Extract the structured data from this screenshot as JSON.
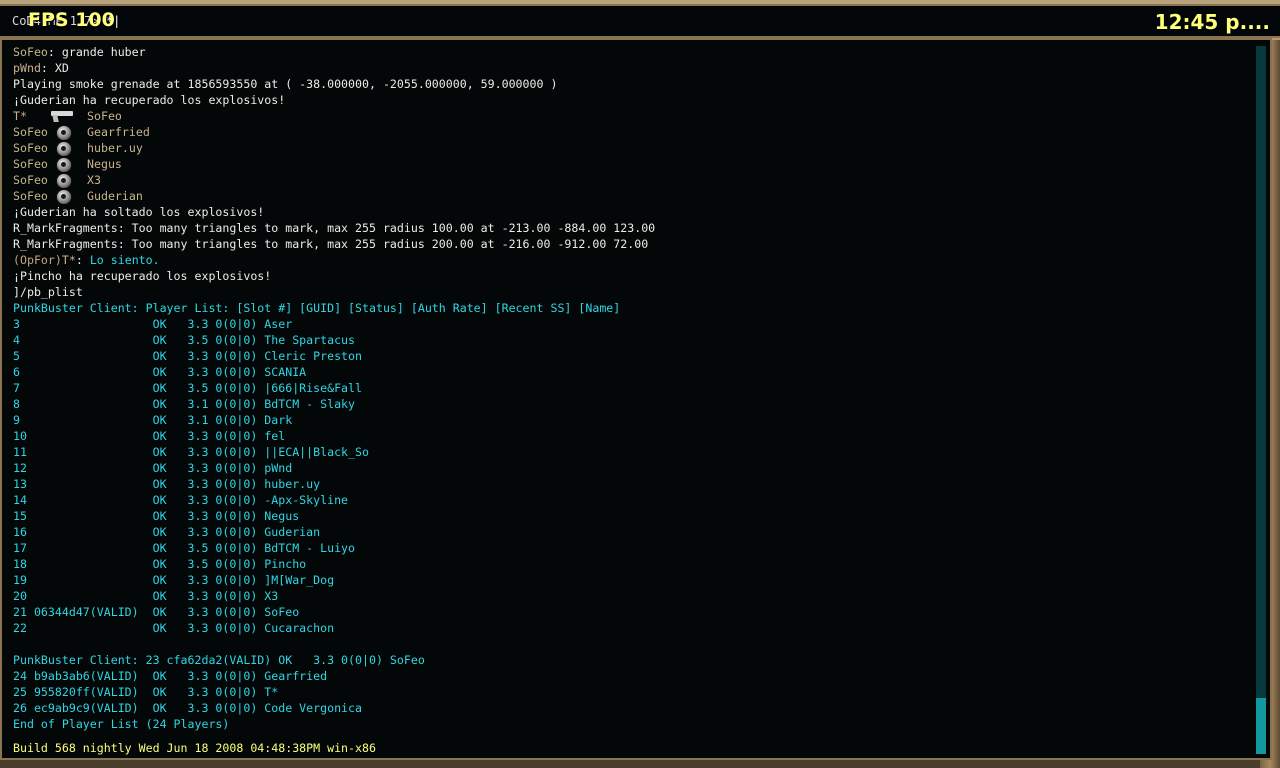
{
  "hud": {
    "fps": "FPS 100",
    "clock": "12:45 p...."
  },
  "input": {
    "prompt": "CoD4 MP 1.7>",
    "value": " *|"
  },
  "log": [
    {
      "type": "text",
      "parts": [
        {
          "t": "SoFeo",
          "c": "tan"
        },
        {
          "t": ": grande huber",
          "c": "w"
        }
      ]
    },
    {
      "type": "text",
      "parts": [
        {
          "t": "pWnd",
          "c": "tan"
        },
        {
          "t": ": XD",
          "c": "w"
        }
      ]
    },
    {
      "type": "text",
      "parts": [
        {
          "t": "Playing smoke grenade at 1856593550 at ( -38.000000, -2055.000000, 59.000000 )",
          "c": "w"
        }
      ]
    },
    {
      "type": "text",
      "parts": [
        {
          "t": "¡Guderian ha recuperado los explosivos!",
          "c": "w"
        }
      ]
    },
    {
      "type": "kill",
      "killer": "T*",
      "icon": "pistol-icon",
      "victim": "SoFeo"
    },
    {
      "type": "kill",
      "killer": "SoFeo",
      "icon": "grenade-icon",
      "victim": "Gearfried"
    },
    {
      "type": "kill",
      "killer": "SoFeo",
      "icon": "grenade-icon",
      "victim": "huber.uy"
    },
    {
      "type": "kill",
      "killer": "SoFeo",
      "icon": "grenade-icon",
      "victim": "Negus"
    },
    {
      "type": "kill",
      "killer": "SoFeo",
      "icon": "grenade-icon",
      "victim": "X3"
    },
    {
      "type": "kill",
      "killer": "SoFeo",
      "icon": "grenade-icon",
      "victim": "Guderian"
    },
    {
      "type": "text",
      "parts": [
        {
          "t": "¡Guderian ha soltado los explosivos!",
          "c": "w"
        }
      ]
    },
    {
      "type": "text",
      "parts": [
        {
          "t": "R_MarkFragments: Too many triangles to mark, max 255 radius 100.00 at -213.00 -884.00 123.00",
          "c": "w"
        }
      ]
    },
    {
      "type": "text",
      "parts": [
        {
          "t": "R_MarkFragments: Too many triangles to mark, max 255 radius 200.00 at -216.00 -912.00 72.00",
          "c": "w"
        }
      ]
    },
    {
      "type": "text",
      "parts": [
        {
          "t": "(OpFor)",
          "c": "op"
        },
        {
          "t": "T*",
          "c": "tan"
        },
        {
          "t": ": ",
          "c": "w"
        },
        {
          "t": "Lo siento.",
          "c": "cy"
        }
      ]
    },
    {
      "type": "text",
      "parts": [
        {
          "t": "¡Pincho ha recuperado los explosivos!",
          "c": "w"
        }
      ]
    },
    {
      "type": "text",
      "parts": [
        {
          "t": "]/pb_plist",
          "c": "w"
        }
      ]
    },
    {
      "type": "text",
      "parts": [
        {
          "t": "PunkBuster Client: Player List: [Slot #] [GUID] [Status] [Auth Rate] [Recent SS] [Name]",
          "c": "cy"
        }
      ]
    },
    {
      "type": "text",
      "parts": [
        {
          "t": "3                   OK   3.3 0(0|0) Aser",
          "c": "cy"
        }
      ]
    },
    {
      "type": "text",
      "parts": [
        {
          "t": "4                   OK   3.5 0(0|0) The Spartacus",
          "c": "cy"
        }
      ]
    },
    {
      "type": "text",
      "parts": [
        {
          "t": "5                   OK   3.3 0(0|0) Cleric Preston",
          "c": "cy"
        }
      ]
    },
    {
      "type": "text",
      "parts": [
        {
          "t": "6                   OK   3.3 0(0|0) SCANIA",
          "c": "cy"
        }
      ]
    },
    {
      "type": "text",
      "parts": [
        {
          "t": "7                   OK   3.5 0(0|0) |666|Rise&Fall",
          "c": "cy"
        }
      ]
    },
    {
      "type": "text",
      "parts": [
        {
          "t": "8                   OK   3.1 0(0|0) BdTCM - Slaky",
          "c": "cy"
        }
      ]
    },
    {
      "type": "text",
      "parts": [
        {
          "t": "9                   OK   3.1 0(0|0) Dark",
          "c": "cy"
        }
      ]
    },
    {
      "type": "text",
      "parts": [
        {
          "t": "10                  OK   3.3 0(0|0) fel",
          "c": "cy"
        }
      ]
    },
    {
      "type": "text",
      "parts": [
        {
          "t": "11                  OK   3.3 0(0|0) ||ECA||Black_So",
          "c": "cy"
        }
      ]
    },
    {
      "type": "text",
      "parts": [
        {
          "t": "12                  OK   3.3 0(0|0) pWnd",
          "c": "cy"
        }
      ]
    },
    {
      "type": "text",
      "parts": [
        {
          "t": "13                  OK   3.3 0(0|0) huber.uy",
          "c": "cy"
        }
      ]
    },
    {
      "type": "text",
      "parts": [
        {
          "t": "14                  OK   3.3 0(0|0) -Apx-Skyline",
          "c": "cy"
        }
      ]
    },
    {
      "type": "text",
      "parts": [
        {
          "t": "15                  OK   3.3 0(0|0) Negus",
          "c": "cy"
        }
      ]
    },
    {
      "type": "text",
      "parts": [
        {
          "t": "16                  OK   3.3 0(0|0) Guderian",
          "c": "cy"
        }
      ]
    },
    {
      "type": "text",
      "parts": [
        {
          "t": "17                  OK   3.5 0(0|0) BdTCM - Luiyo",
          "c": "cy"
        }
      ]
    },
    {
      "type": "text",
      "parts": [
        {
          "t": "18                  OK   3.5 0(0|0) Pincho",
          "c": "cy"
        }
      ]
    },
    {
      "type": "text",
      "parts": [
        {
          "t": "19                  OK   3.3 0(0|0) ]M[War_Dog",
          "c": "cy"
        }
      ]
    },
    {
      "type": "text",
      "parts": [
        {
          "t": "20                  OK   3.3 0(0|0) X3",
          "c": "cy"
        }
      ]
    },
    {
      "type": "text",
      "parts": [
        {
          "t": "21 06344d47(VALID)  OK   3.3 0(0|0) SoFeo",
          "c": "cy"
        }
      ]
    },
    {
      "type": "text",
      "parts": [
        {
          "t": "22                  OK   3.3 0(0|0) Cucarachon",
          "c": "cy"
        }
      ]
    },
    {
      "type": "text",
      "parts": [
        {
          "t": "",
          "c": "cy"
        }
      ]
    },
    {
      "type": "text",
      "parts": [
        {
          "t": "PunkBuster Client: 23 cfa62da2(VALID) OK   3.3 0(0|0) SoFeo",
          "c": "cy"
        }
      ]
    },
    {
      "type": "text",
      "parts": [
        {
          "t": "24 b9ab3ab6(VALID)  OK   3.3 0(0|0) Gearfried",
          "c": "cy"
        }
      ]
    },
    {
      "type": "text",
      "parts": [
        {
          "t": "25 955820ff(VALID)  OK   3.3 0(0|0) T*",
          "c": "cy"
        }
      ]
    },
    {
      "type": "text",
      "parts": [
        {
          "t": "26 ec9ab9c9(VALID)  OK   3.3 0(0|0) Code Vergonica",
          "c": "cy"
        }
      ]
    },
    {
      "type": "text",
      "parts": [
        {
          "t": "End of Player List (24 Players)",
          "c": "cy"
        }
      ]
    }
  ],
  "build": "Build 568 nightly Wed Jun 18 2008 04:48:38PM win-x86",
  "colors": {
    "cyan": "#2fd6e3",
    "name_tan": "#c9b38b",
    "hud_yellow": "#ffff7a",
    "white": "#ecece6"
  },
  "scroll": {
    "position_fraction": 1.0
  }
}
